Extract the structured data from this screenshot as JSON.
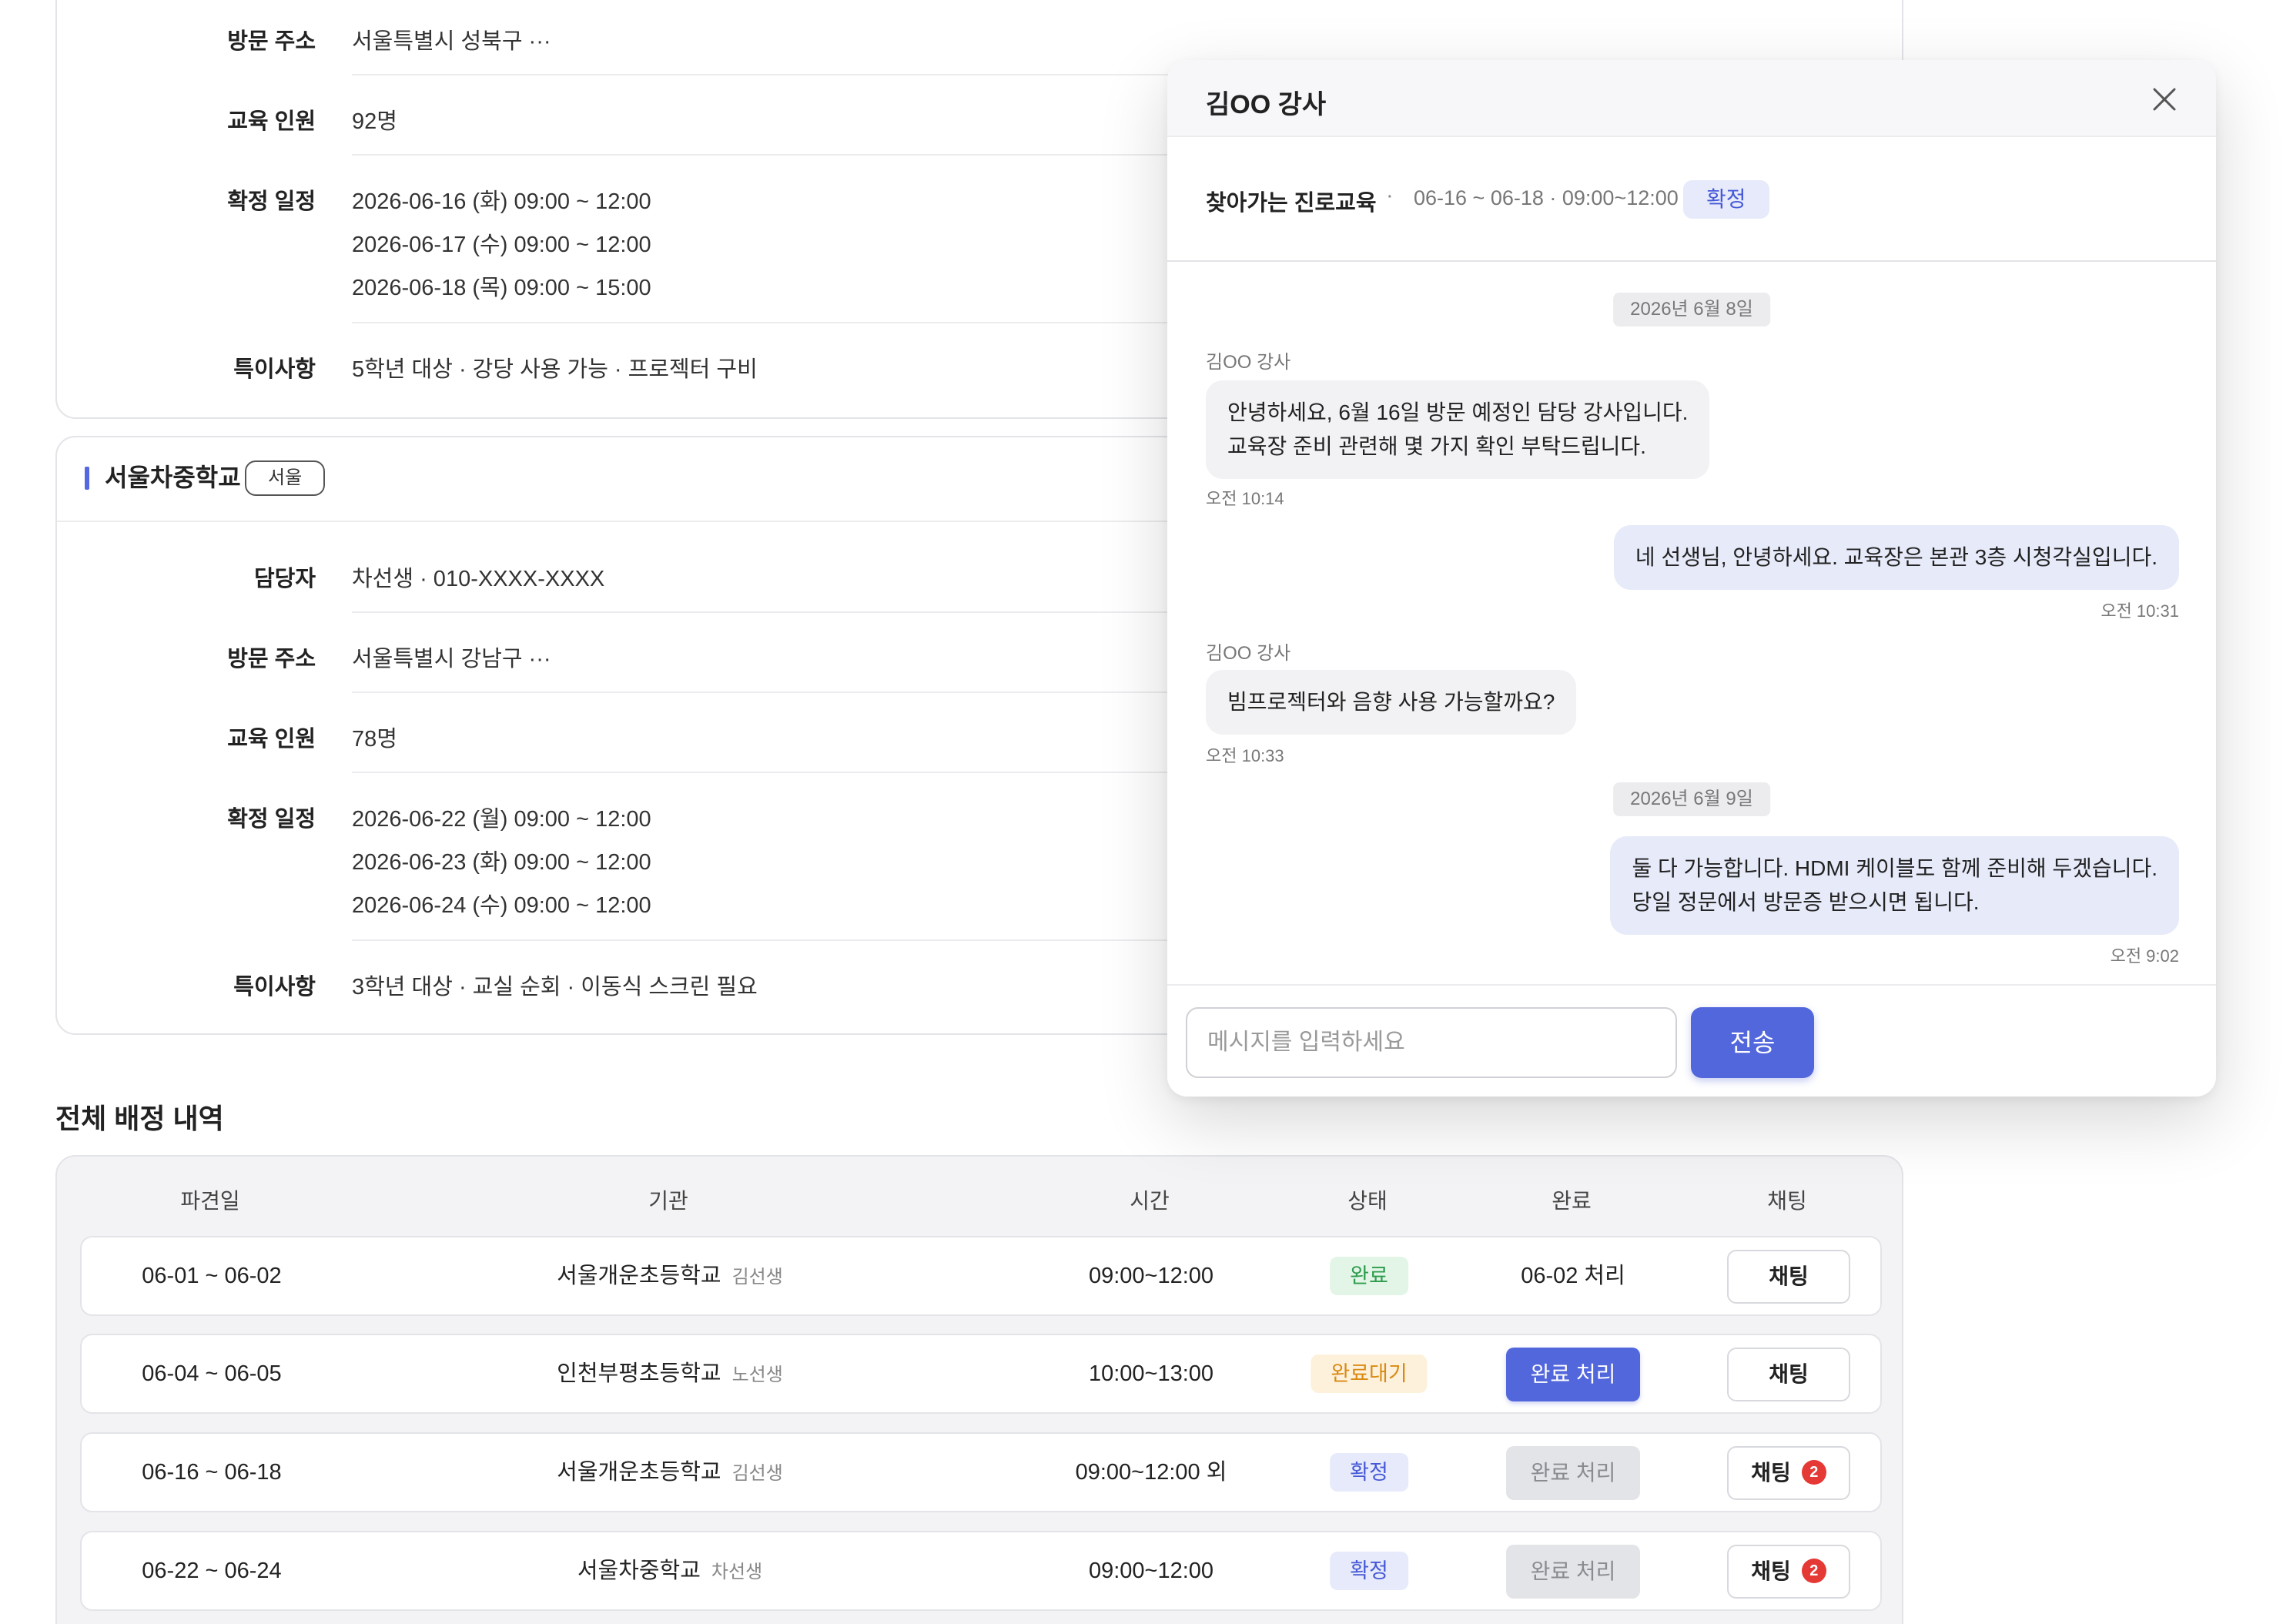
{
  "card1": {
    "address_label": "방문 주소",
    "address": "서울특별시 성북구 ···",
    "people_label": "교육 인원",
    "people": "92명",
    "schedule_label": "확정 일정",
    "schedule": [
      "2026-06-16 (화) 09:00 ~ 12:00",
      "2026-06-17 (수) 09:00 ~ 12:00",
      "2026-06-18 (목) 09:00 ~ 15:00"
    ],
    "notes_label": "특이사항",
    "notes": "5학년 대상 · 강당 사용 가능 · 프로젝터 구비"
  },
  "card2": {
    "org": "서울차중학교",
    "region": "서울",
    "contact_label": "담당자",
    "contact": "차선생 · 010-XXXX-XXXX",
    "address_label": "방문 주소",
    "address": "서울특별시 강남구 ···",
    "people_label": "교육 인원",
    "people": "78명",
    "schedule_label": "확정 일정",
    "schedule": [
      "2026-06-22 (월) 09:00 ~ 12:00",
      "2026-06-23 (화) 09:00 ~ 12:00",
      "2026-06-24 (수) 09:00 ~ 12:00"
    ],
    "notes_label": "특이사항",
    "notes": "3학년 대상 · 교실 순회 · 이동식 스크린 필요"
  },
  "table": {
    "title": "전체 배정 내역",
    "headers": [
      "파견일",
      "기관",
      "시간",
      "상태",
      "완료",
      "채팅"
    ],
    "rows": [
      {
        "dates": "06-01 ~ 06-02",
        "org": "서울개운초등학교",
        "teacher": "김선생",
        "time": "09:00~12:00",
        "status": "완료",
        "status_type": "done",
        "complete": "06-02 처리",
        "complete_type": "text",
        "chat": "채팅",
        "badge": ""
      },
      {
        "dates": "06-04 ~ 06-05",
        "org": "인천부평초등학교",
        "teacher": "노선생",
        "time": "10:00~13:00",
        "status": "완료대기",
        "status_type": "wait",
        "complete": "완료 처리",
        "complete_type": "active",
        "chat": "채팅",
        "badge": ""
      },
      {
        "dates": "06-16 ~ 06-18",
        "org": "서울개운초등학교",
        "teacher": "김선생",
        "time": "09:00~12:00 외",
        "status": "확정",
        "status_type": "conf",
        "complete": "완료 처리",
        "complete_type": "disabled",
        "chat": "채팅",
        "badge": "2"
      },
      {
        "dates": "06-22 ~ 06-24",
        "org": "서울차중학교",
        "teacher": "차선생",
        "time": "09:00~12:00",
        "status": "확정",
        "status_type": "conf",
        "complete": "완료 처리",
        "complete_type": "disabled",
        "chat": "채팅",
        "badge": "2"
      }
    ]
  },
  "chat": {
    "title": "김OO 강사",
    "program": "찾아가는 진로교육",
    "separator": "·",
    "date_range": "06-16 ~ 06-18 · 09:00~12:00",
    "status": "확정",
    "date_chips": [
      "2026년 6월 8일",
      "2026년 6월 9일"
    ],
    "messages": [
      {
        "side": "in",
        "sender": "김OO 강사",
        "lines": [
          "안녕하세요, 6월 16일 방문 예정인 담당 강사입니다.",
          "교육장 준비 관련해 몇 가지 확인 부탁드립니다."
        ],
        "time": "오전 10:14"
      },
      {
        "side": "out",
        "sender": "",
        "lines": [
          "네 선생님, 안녕하세요. 교육장은 본관 3층 시청각실입니다."
        ],
        "time": "오전 10:31"
      },
      {
        "side": "in",
        "sender": "김OO 강사",
        "lines": [
          "빔프로젝터와 음향 사용 가능할까요?"
        ],
        "time": "오전 10:33"
      },
      {
        "side": "out",
        "sender": "",
        "lines": [
          "둘 다 가능합니다. HDMI 케이블도 함께 준비해 두겠습니다.",
          "당일 정문에서 방문증 받으시면 됩니다."
        ],
        "time": "오전 9:02"
      }
    ],
    "input_placeholder": "메시지를 입력하세요",
    "send_label": "전송"
  },
  "colors": {
    "accent": "#5367dd",
    "done": "#2e9c4d",
    "wait": "#d98a12",
    "badge": "#e53935"
  }
}
